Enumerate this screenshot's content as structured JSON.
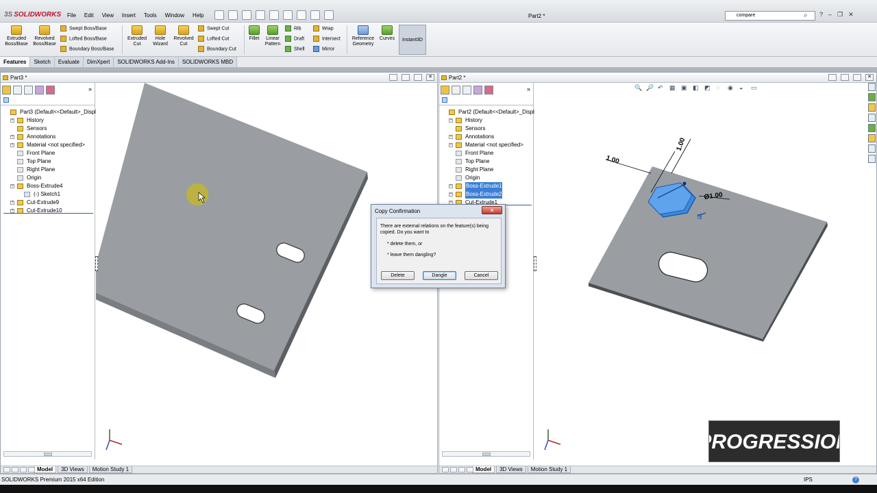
{
  "app": {
    "logo_ds": "3S",
    "logo_text": "SOLIDWORKS",
    "doc_title": "Part2 *",
    "menu": [
      "File",
      "Edit",
      "View",
      "Insert",
      "Tools",
      "Window",
      "Help"
    ],
    "search_value": "compare",
    "window_controls": [
      "?",
      "–",
      "❐",
      "✕"
    ]
  },
  "ribbon": {
    "extruded_boss": "Extruded Boss/Base",
    "revolved_boss": "Revolved Boss/Base",
    "swept_boss": "Swept Boss/Base",
    "lofted_boss": "Lofted Boss/Base",
    "boundary_boss": "Boundary Boss/Base",
    "extruded_cut": "Extruded Cut",
    "hole_wizard": "Hole Wizard",
    "revolved_cut": "Revolved Cut",
    "swept_cut": "Swept Cut",
    "lofted_cut": "Lofted Cut",
    "boundary_cut": "Boundary Cut",
    "fillet": "Fillet",
    "linear_pattern": "Linear Pattern",
    "rib": "Rib",
    "draft": "Draft",
    "shell": "Shell",
    "wrap": "Wrap",
    "intersect": "Intersect",
    "mirror": "Mirror",
    "reference_geometry": "Reference Geometry",
    "curves": "Curves",
    "instant3d": "Instant3D"
  },
  "cmd_tabs": [
    "Features",
    "Sketch",
    "Evaluate",
    "DimXpert",
    "SOLIDWORKS Add-Ins",
    "SOLIDWORKS MBD"
  ],
  "left_doc": {
    "title": "Part3 *",
    "tree": [
      {
        "label": "Part3  (Default<<Default>_Displa",
        "indent": 0,
        "exp": false,
        "icon": "part"
      },
      {
        "label": "History",
        "indent": 1,
        "exp": true,
        "icon": "folder"
      },
      {
        "label": "Sensors",
        "indent": 1,
        "exp": false,
        "icon": "folder"
      },
      {
        "label": "Annotations",
        "indent": 1,
        "exp": true,
        "icon": "annot"
      },
      {
        "label": "Material <not specified>",
        "indent": 1,
        "exp": true,
        "icon": "mat"
      },
      {
        "label": "Front Plane",
        "indent": 1,
        "exp": false,
        "icon": "plane"
      },
      {
        "label": "Top Plane",
        "indent": 1,
        "exp": false,
        "icon": "plane"
      },
      {
        "label": "Right Plane",
        "indent": 1,
        "exp": false,
        "icon": "plane"
      },
      {
        "label": "Origin",
        "indent": 1,
        "exp": false,
        "icon": "origin"
      },
      {
        "label": "Boss-Extrude4",
        "indent": 1,
        "exp": true,
        "icon": "feat"
      },
      {
        "label": "(-) Sketch1",
        "indent": 2,
        "exp": false,
        "icon": "sketch"
      },
      {
        "label": "Cut-Extrude9",
        "indent": 1,
        "exp": true,
        "icon": "feat"
      },
      {
        "label": "Cut-Extrude10",
        "indent": 1,
        "exp": true,
        "icon": "feat"
      }
    ],
    "tabs": [
      "Model",
      "3D Views",
      "Motion Study 1"
    ]
  },
  "right_doc": {
    "title": "Part2 *",
    "tree": [
      {
        "label": "Part2  (Default<<Default>_Displa",
        "indent": 0,
        "exp": false,
        "icon": "part",
        "sel": false
      },
      {
        "label": "History",
        "indent": 1,
        "exp": true,
        "icon": "folder",
        "sel": false
      },
      {
        "label": "Sensors",
        "indent": 1,
        "exp": false,
        "icon": "folder",
        "sel": false
      },
      {
        "label": "Annotations",
        "indent": 1,
        "exp": true,
        "icon": "annot",
        "sel": false
      },
      {
        "label": "Material <not specified>",
        "indent": 1,
        "exp": true,
        "icon": "mat",
        "sel": false
      },
      {
        "label": "Front Plane",
        "indent": 1,
        "exp": false,
        "icon": "plane",
        "sel": false
      },
      {
        "label": "Top Plane",
        "indent": 1,
        "exp": false,
        "icon": "plane",
        "sel": false
      },
      {
        "label": "Right Plane",
        "indent": 1,
        "exp": false,
        "icon": "plane",
        "sel": false
      },
      {
        "label": "Origin",
        "indent": 1,
        "exp": false,
        "icon": "origin",
        "sel": false
      },
      {
        "label": "Boss-Extrude1",
        "indent": 1,
        "exp": true,
        "icon": "feat",
        "sel": true
      },
      {
        "label": "Boss-Extrude2",
        "indent": 1,
        "exp": true,
        "icon": "feat",
        "sel": true
      },
      {
        "label": "Cut-Extrude1",
        "indent": 1,
        "exp": true,
        "icon": "feat",
        "sel": false
      }
    ],
    "tabs": [
      "Model",
      "3D Views",
      "Motion Study 1"
    ],
    "dims": {
      "d1": "1.00",
      "d2": "1.00",
      "dia": "Ø1.00"
    }
  },
  "dialog": {
    "title": "Copy Confirmation",
    "close": "✕",
    "message": "There are external relations on the feature(s) being copied.  Do you want to",
    "option1": "* delete them, or",
    "option2": "* leave them dangling?",
    "btn_delete": "Delete",
    "btn_dangle": "Dangle",
    "btn_cancel": "Cancel"
  },
  "status": {
    "edition": "SOLIDWORKS Premium 2015 x64 Edition",
    "units": "IPS",
    "help": "?"
  },
  "watermark": "PROGRESSION",
  "colors": {
    "part_face": "#999ca1",
    "part_edge": "#6f7277",
    "selection": "#3d7fd6",
    "hex_fill": "#3a8be0",
    "dimension": "#000000",
    "accent_red": "#c8102e"
  }
}
